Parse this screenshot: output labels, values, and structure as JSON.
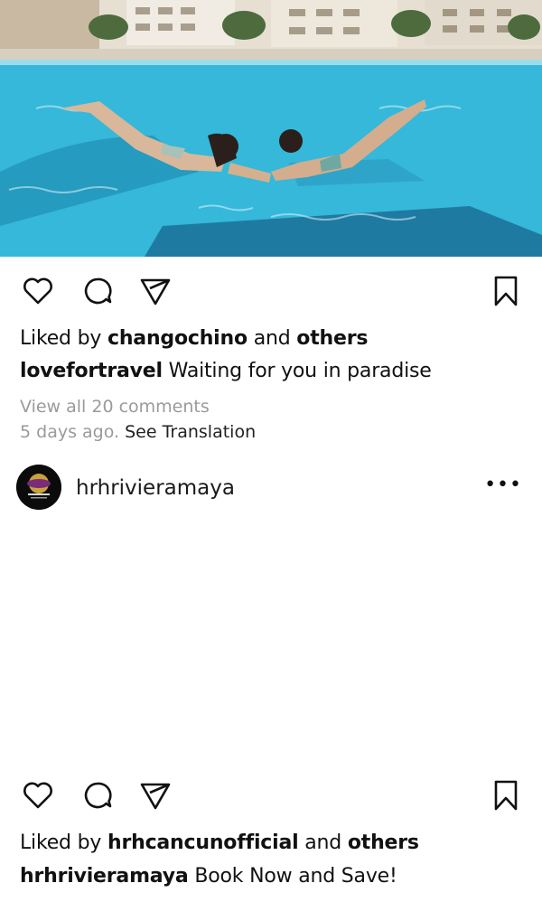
{
  "post1": {
    "image_alt": "Two women swimming underwater in a resort pool holding hands",
    "actions": {
      "like_icon": "heart-icon",
      "comment_icon": "comment-icon",
      "share_icon": "send-icon",
      "save_icon": "bookmark-icon"
    },
    "liked_by_prefix": "Liked by",
    "liked_by_user": "changochino",
    "liked_by_and": "and",
    "liked_by_others": "others",
    "caption_user": "lovefortravel",
    "caption_text": "Waiting for you in paradise",
    "view_comments": "View all 20 comments",
    "time_ago": "5 days ago.",
    "see_translation": "See Translation"
  },
  "post2": {
    "username": "hrhrivieramaya",
    "more_label": "•••",
    "liked_by_prefix": "Liked by",
    "liked_by_user": "hrhcancunofficial",
    "liked_by_and": "and",
    "liked_by_others": "others",
    "caption_user": "hrhrivieramaya",
    "caption_text": "Book Now and Save!"
  },
  "colors": {
    "pool": "#37b9db",
    "muted_text": "#9a9a9a"
  }
}
